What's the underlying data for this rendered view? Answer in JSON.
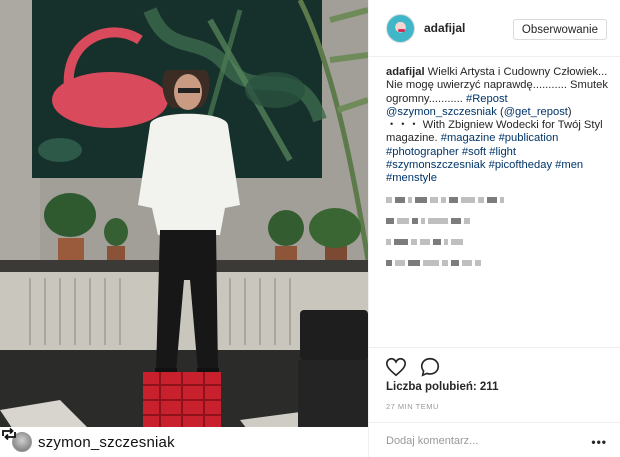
{
  "post_image": {
    "repost_user": "szymon_szczesniak"
  },
  "header": {
    "username": "adafijal",
    "follow_label": "Obserwowanie"
  },
  "caption": {
    "author": "adafijal",
    "text_1": " Wielki Artysta i Cudowny Człowiek... Nie mogę uwierzyć naprawdę........... Smutek ogromny........... ",
    "tag_repost": "#Repost",
    "space_1": " ",
    "mention_1": "@szymon_szczesniak",
    "open_paren": " (",
    "mention_2": "@get_repost",
    "close_paren": ")",
    "text_2": " ・・・ With Zbigniew Wodecki for Twój Styl magazine. ",
    "hashtags": [
      "#magazine",
      "#publication",
      "#photographer",
      "#soft",
      "#light",
      "#szymonszczesniak",
      "#picoftheday",
      "#men",
      "#menstyle"
    ]
  },
  "actions": {
    "like_icon": "heart-icon",
    "comment_icon": "speech-bubble-icon",
    "likes_label": "Liczba polubień: 211",
    "time_ago": "27 MIN TEMU",
    "comment_placeholder": "Dodaj komentarz...",
    "more_label": "•••"
  }
}
